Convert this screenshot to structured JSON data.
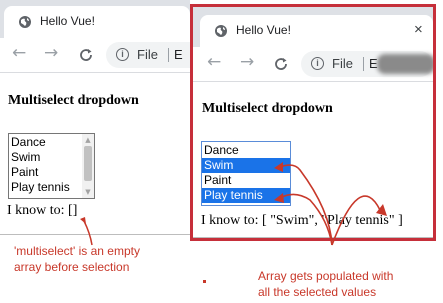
{
  "browser": {
    "tab_title": "Hello Vue!",
    "close_glyph": "×",
    "back_glyph": "←",
    "forward_glyph": "→",
    "reload_glyph": "C",
    "info_glyph": "i",
    "scheme_label": "File",
    "url_text_left": "E",
    "url_text_right": "E"
  },
  "page": {
    "heading": "Multiselect dropdown",
    "listbox_options": [
      "Dance",
      "Swim",
      "Paint",
      "Play tennis"
    ],
    "selected_options": [
      "Swim",
      "Play tennis"
    ],
    "result_before": "I know to: []",
    "result_after": "I know to: [ \"Swim\", \"Play tennis\" ]"
  },
  "annotations": {
    "left_note": [
      "'multiselect' is an empty",
      "array before selection"
    ],
    "right_note": [
      "Array gets populated with",
      "all the selected values"
    ],
    "color": "#c8382a"
  }
}
